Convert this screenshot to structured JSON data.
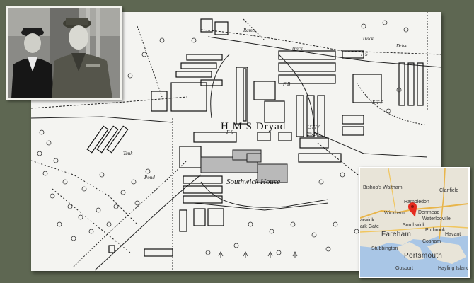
{
  "map": {
    "station_label": "H M S Dryad",
    "house_label": "Southwick House",
    "track_labels": [
      "Ramp",
      "Track",
      "Track",
      "Drive"
    ],
    "numbers": [
      "3777",
      "25.55"
    ],
    "minor_labels": [
      "F S",
      "F S",
      "F B",
      "E T P",
      "Tank",
      "Pond"
    ]
  },
  "photo": {
    "subject": "two officers in uniform"
  },
  "inset": {
    "towns": [
      "Bishop's Waltham",
      "Clanfield",
      "Hambledon",
      "Denmead",
      "Waterlooville",
      "Wickham",
      "Southwick",
      "Purbrook",
      "Havant",
      "Fareham",
      "Cosham",
      "Stubbington",
      "Portsmouth",
      "Gosport",
      "Hayling Island",
      "arwick",
      "ark Gate"
    ],
    "marker_color": "#e52b1f",
    "water_color": "#a9c6e6",
    "land_color": "#e8e4d8"
  }
}
